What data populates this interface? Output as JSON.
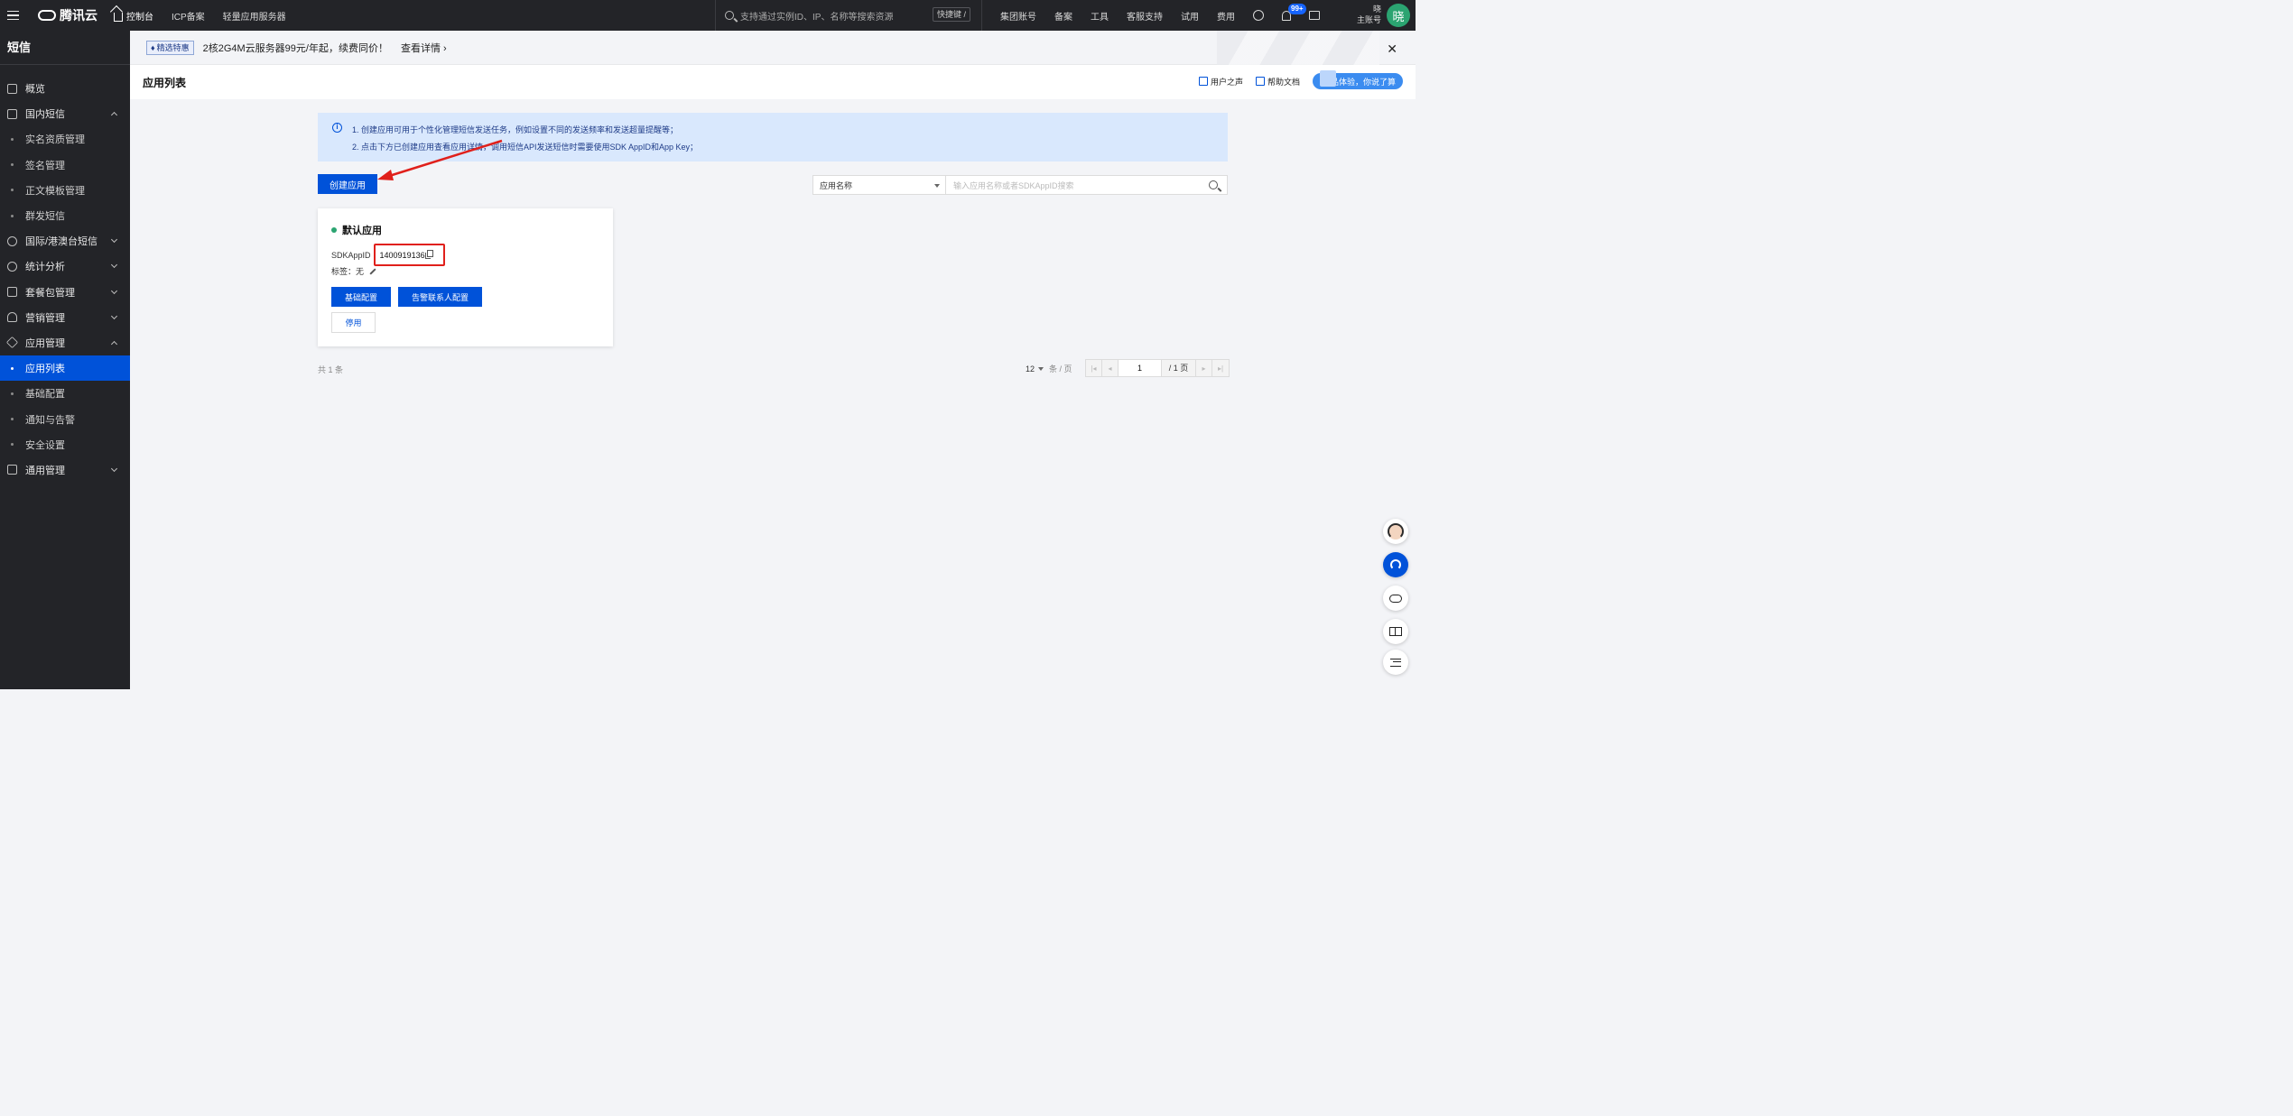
{
  "topbar": {
    "brand": "腾讯云",
    "nav": [
      "控制台",
      "ICP备案",
      "轻量应用服务器"
    ],
    "search_placeholder": "支持通过实例ID、IP、名称等搜索资源",
    "shortcut": "快捷键 /",
    "right_links": [
      "集团账号",
      "备案",
      "工具",
      "客服支持",
      "试用",
      "费用"
    ],
    "notification_count": "99+",
    "account_name": "晓",
    "account_type": "主账号",
    "avatar_text": "晓"
  },
  "sidebar": {
    "title": "短信",
    "items": [
      {
        "label": "概览",
        "icon": "grid-icon",
        "type": "top"
      },
      {
        "label": "国内短信",
        "icon": "mail-icon",
        "type": "top",
        "expanded": true
      },
      {
        "label": "实名资质管理",
        "type": "sub"
      },
      {
        "label": "签名管理",
        "type": "sub"
      },
      {
        "label": "正文模板管理",
        "type": "sub"
      },
      {
        "label": "群发短信",
        "type": "sub"
      },
      {
        "label": "国际/港澳台短信",
        "icon": "globe-icon",
        "type": "top",
        "expanded": false
      },
      {
        "label": "统计分析",
        "icon": "chart-icon",
        "type": "top",
        "expanded": false
      },
      {
        "label": "套餐包管理",
        "icon": "package-icon",
        "type": "top",
        "expanded": false
      },
      {
        "label": "营销管理",
        "icon": "user-icon",
        "type": "top",
        "expanded": false
      },
      {
        "label": "应用管理",
        "icon": "layers-icon",
        "type": "top",
        "expanded": true
      },
      {
        "label": "应用列表",
        "type": "sub",
        "active": true
      },
      {
        "label": "基础配置",
        "type": "sub"
      },
      {
        "label": "通知与告警",
        "type": "sub"
      },
      {
        "label": "安全设置",
        "type": "sub"
      },
      {
        "label": "通用管理",
        "icon": "settings-icon",
        "type": "top",
        "expanded": false
      }
    ]
  },
  "banner": {
    "tag": "精选特惠",
    "text": "2核2G4M云服务器99元/年起，续费同价！",
    "link": "查看详情"
  },
  "page": {
    "title": "应用列表",
    "links": [
      "用户之声",
      "帮助文档"
    ],
    "feedback": "产品体验，你说了算"
  },
  "info": {
    "lines": [
      "1. 创建应用可用于个性化管理短信发送任务，例如设置不同的发送频率和发送超量提醒等；",
      "2. 点击下方已创建应用查看应用详情，调用短信API发送短信时需要使用SDK AppID和App Key；"
    ]
  },
  "toolbar": {
    "create_label": "创建应用",
    "filter_field": "应用名称",
    "search_placeholder": "输入应用名称或者SDKAppID搜索"
  },
  "app_card": {
    "name": "默认应用",
    "appid_label": "SDKAppID",
    "appid": "1400919136",
    "tag_label": "标签：无",
    "btn_basic": "基础配置",
    "btn_alarm": "告警联系人配置",
    "btn_stop": "停用"
  },
  "pagination": {
    "total": "共 1 条",
    "page_size": "12",
    "page_size_unit": "条 / 页",
    "current_page": "1",
    "total_pages": "/ 1 页"
  },
  "colors": {
    "primary": "#0052d9",
    "sidebar_bg": "#232428",
    "annotation_red": "#e0201b",
    "status_green": "#2ba471"
  }
}
